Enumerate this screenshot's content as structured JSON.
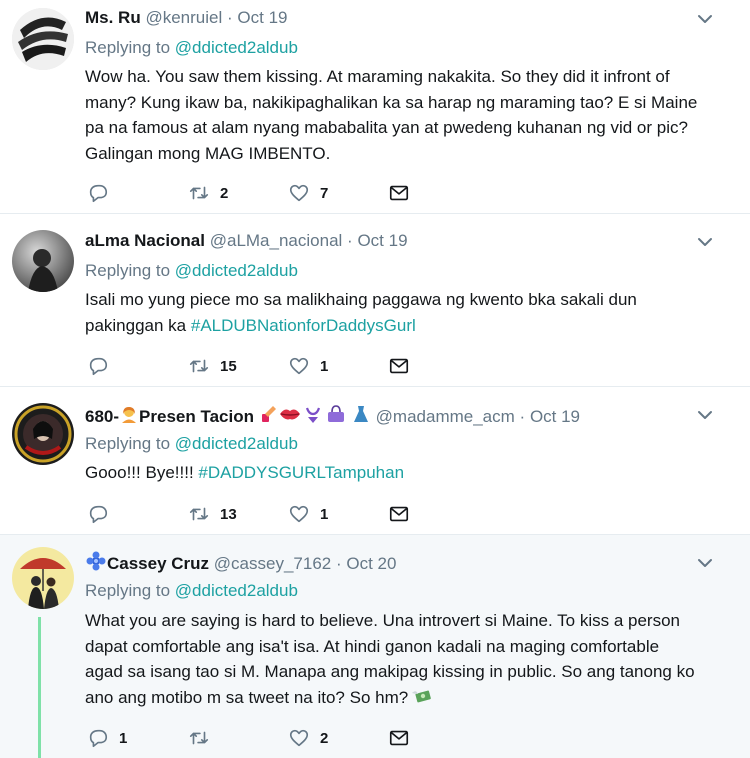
{
  "tweets": [
    {
      "name": "Ms. Ru",
      "handle": "@kenruiel",
      "dot": "·",
      "date": "Oct 19",
      "replying_prefix": "Replying to",
      "replying_to": "@ddicted2aldub",
      "text_lines": [
        "Wow ha. You saw them kissing. At maraming nakakita. So they did it infront of",
        "many? Kung ikaw ba, nakikipaghalikan ka sa harap ng maraming tao? E si Maine",
        "pa na famous at alam nyang mababalita yan at pwedeng kuhanan ng vid or pic?",
        "Galingan mong  MAG IMBENTO."
      ],
      "reply_count": "",
      "retweet_count": "2",
      "like_count": "7"
    },
    {
      "name": "aLma Nacional",
      "handle": "@aLMa_nacional",
      "dot": "·",
      "date": "Oct 19",
      "replying_prefix": "Replying to",
      "replying_to": "@ddicted2aldub",
      "text_line1": "Isali mo yung piece mo sa malikhaing paggawa ng kwento bka sakali dun",
      "text_line2_plain": "pakinggan ka ",
      "text_line2_hashtag": "#ALDUBNationforDaddysGurl",
      "reply_count": "",
      "retweet_count": "15",
      "like_count": "1"
    },
    {
      "name_prefix": "680-",
      "name_main": "Presen Tacion",
      "handle": "@madamme_acm",
      "dot": "·",
      "date": "Oct 19",
      "replying_prefix": "Replying to",
      "replying_to": "@ddicted2aldub",
      "text_plain": "Gooo!!! Bye!!!! ",
      "text_hashtag": "#DADDYSGURLTampuhan",
      "reply_count": "",
      "retweet_count": "13",
      "like_count": "1"
    },
    {
      "name": "Cassey Cruz",
      "handle": "@cassey_7162",
      "dot": "·",
      "date": "Oct 20",
      "replying_prefix": "Replying to",
      "replying_to": "@ddicted2aldub",
      "text_lines": [
        "What you are saying is hard to believe. Una introvert si Maine. To kiss a person",
        "dapat comfortable ang isa't isa. At hindi ganon kadali na maging comfortable",
        "agad sa isang tao si M. Manapa ang makipag kissing in public. So ang tanong ko",
        "ano ang motibo m sa tweet na ito? So hm?"
      ],
      "reply_count": "1",
      "retweet_count": "",
      "like_count": "2"
    }
  ],
  "colors": {
    "link": "#1da1a2",
    "muted": "#657786",
    "thread_line": "#7fe1a8",
    "highlight_bg": "#f5f8fa"
  },
  "icons": [
    "reply-icon",
    "retweet-icon",
    "like-icon",
    "message-icon",
    "caret-down-icon"
  ]
}
